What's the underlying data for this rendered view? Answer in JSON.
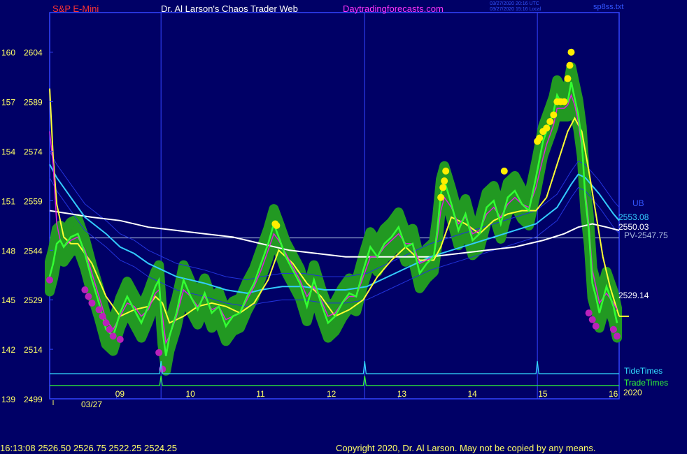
{
  "header": {
    "symbol": "S&P E-Mini",
    "site": "Dr. Al Larson's Chaos Trader Web",
    "url": "Daytradingforecasts.com",
    "time_utc": "03/27/2020 20:16 UTC",
    "time_local": "03/27/2020 15:16 Local",
    "file": "sp8ss.txt"
  },
  "footer": {
    "quote": "16:13:08  2526.50  2526.75  2522.25  2524.25",
    "copyright": "Copyright 2020, Dr. Al Larson. May not be copied by any means."
  },
  "colors": {
    "background": "#000066",
    "price": "#33ff33",
    "band": "#229922",
    "ema_fast": "#dd22dd",
    "ema_mid": "#ffff33",
    "ema_slow": "#33ccff",
    "ema_long": "#ffffff",
    "envelope": "#2233dd",
    "axis": "#3344ff",
    "tide": "#33ddff",
    "trade": "#33ff33"
  },
  "chart_data": {
    "type": "line",
    "x_tick_labels": [
      "09",
      "10",
      "11",
      "12",
      "13",
      "14",
      "15",
      "16"
    ],
    "x_ticks": [
      9,
      10,
      11,
      12,
      13,
      14,
      15,
      16
    ],
    "date_label": "03/27",
    "year_label": "2020",
    "xlim": [
      8.0,
      16.08
    ],
    "ylim": [
      2499,
      2616
    ],
    "y_ticks": [
      {
        "value": 2499,
        "left": "139",
        "right": "2499"
      },
      {
        "value": 2514,
        "left": "142",
        "right": "2514"
      },
      {
        "value": 2529,
        "left": "145",
        "right": "2529"
      },
      {
        "value": 2544,
        "left": "148",
        "right": "2544"
      },
      {
        "value": 2559,
        "left": "151",
        "right": "2559"
      },
      {
        "value": 2574,
        "left": "154",
        "right": "2574"
      },
      {
        "value": 2589,
        "left": "157",
        "right": "2589"
      },
      {
        "value": 2604,
        "left": "160",
        "right": "2604"
      }
    ],
    "vertical_markers": [
      9.58,
      12.47,
      14.92
    ],
    "pv_level": 2547.75,
    "labels": {
      "ub": "UB",
      "pv": "PV-2547.75",
      "tide": "TideTimes",
      "trade": "TradeTimes",
      "ema_slow_last": "2553.08",
      "ema_long_last": "2550.03",
      "ema_mid_last": "2529.14"
    },
    "tide_spikes": [
      9.58,
      12.47,
      14.92
    ],
    "trade_spikes": [
      9.58,
      12.47
    ],
    "price": {
      "x": [
        8.0,
        8.05,
        8.1,
        8.15,
        8.2,
        8.3,
        8.4,
        8.5,
        8.6,
        8.7,
        8.8,
        8.9,
        9.0,
        9.1,
        9.2,
        9.3,
        9.4,
        9.5,
        9.55,
        9.6,
        9.65,
        9.7,
        9.8,
        9.9,
        10.0,
        10.1,
        10.2,
        10.3,
        10.4,
        10.5,
        10.6,
        10.7,
        10.8,
        10.9,
        11.0,
        11.1,
        11.18,
        11.25,
        11.35,
        11.45,
        11.55,
        11.65,
        11.75,
        11.85,
        11.95,
        12.05,
        12.15,
        12.25,
        12.35,
        12.45,
        12.55,
        12.65,
        12.75,
        12.85,
        12.95,
        13.05,
        13.15,
        13.25,
        13.35,
        13.45,
        13.5,
        13.55,
        13.6,
        13.7,
        13.8,
        13.9,
        14.0,
        14.1,
        14.2,
        14.3,
        14.4,
        14.5,
        14.6,
        14.7,
        14.8,
        14.9,
        15.0,
        15.05,
        15.1,
        15.15,
        15.2,
        15.25,
        15.3,
        15.35,
        15.4,
        15.45,
        15.5,
        15.55,
        15.6,
        15.65,
        15.7,
        15.75,
        15.8,
        15.9,
        16.0,
        16.05
      ],
      "y": [
        2536,
        2540,
        2546,
        2547,
        2545,
        2548,
        2549,
        2543,
        2535,
        2528,
        2520,
        2518,
        2525,
        2530,
        2526,
        2522,
        2527,
        2533,
        2535,
        2520,
        2512,
        2518,
        2525,
        2535,
        2530,
        2526,
        2531,
        2525,
        2527,
        2521,
        2524,
        2525,
        2530,
        2534,
        2540,
        2546,
        2552,
        2548,
        2542,
        2538,
        2534,
        2527,
        2535,
        2528,
        2522,
        2524,
        2528,
        2531,
        2530,
        2538,
        2545,
        2542,
        2546,
        2548,
        2551,
        2545,
        2546,
        2537,
        2540,
        2542,
        2550,
        2561,
        2565,
        2558,
        2550,
        2555,
        2547,
        2549,
        2557,
        2559,
        2552,
        2560,
        2562,
        2558,
        2556,
        2566,
        2577,
        2580,
        2583,
        2586,
        2591,
        2589,
        2589,
        2589,
        2595,
        2590,
        2585,
        2577,
        2560,
        2550,
        2534,
        2530,
        2525,
        2533,
        2527,
        2522
      ]
    },
    "ema_fast": {
      "x": [
        8.0,
        8.05,
        8.1,
        8.15,
        8.2,
        8.3,
        8.4,
        8.5,
        8.6,
        8.7,
        8.8,
        8.9,
        9.0,
        9.1,
        9.2,
        9.3,
        9.4,
        9.5,
        9.55,
        9.6,
        9.65,
        9.7,
        9.8,
        9.9,
        10.0,
        10.1,
        10.2,
        10.3,
        10.4,
        10.5,
        10.6,
        10.7,
        10.8,
        10.9,
        11.0,
        11.1,
        11.18,
        11.25,
        11.35,
        11.45,
        11.55,
        11.65,
        11.75,
        11.85,
        11.95,
        12.05,
        12.15,
        12.25,
        12.35,
        12.45,
        12.55,
        12.65,
        12.75,
        12.85,
        12.95,
        13.05,
        13.15,
        13.25,
        13.35,
        13.45,
        13.5,
        13.55,
        13.6,
        13.7,
        13.8,
        13.9,
        14.0,
        14.1,
        14.2,
        14.3,
        14.4,
        14.5,
        14.6,
        14.7,
        14.8,
        14.9,
        15.0,
        15.05,
        15.1,
        15.15,
        15.2,
        15.25,
        15.3,
        15.35,
        15.4,
        15.45,
        15.5,
        15.55,
        15.6,
        15.65,
        15.7,
        15.75,
        15.8,
        15.9,
        16.0,
        16.05
      ],
      "y": [
        2580,
        2570,
        2552,
        2547,
        2545,
        2547,
        2548,
        2544,
        2537,
        2530,
        2523,
        2520,
        2524,
        2528,
        2527,
        2524,
        2526,
        2531,
        2532,
        2524,
        2516,
        2518,
        2524,
        2532,
        2530,
        2527,
        2530,
        2526,
        2527,
        2523,
        2524,
        2525,
        2529,
        2533,
        2538,
        2544,
        2549,
        2547,
        2543,
        2539,
        2535,
        2530,
        2533,
        2529,
        2524,
        2525,
        2528,
        2530,
        2530,
        2536,
        2542,
        2542,
        2545,
        2547,
        2549,
        2546,
        2546,
        2540,
        2541,
        2542,
        2548,
        2556,
        2560,
        2557,
        2552,
        2554,
        2549,
        2550,
        2555,
        2557,
        2554,
        2558,
        2560,
        2558,
        2557,
        2563,
        2572,
        2576,
        2579,
        2582,
        2587,
        2587,
        2587,
        2588,
        2591,
        2588,
        2583,
        2575,
        2562,
        2552,
        2538,
        2533,
        2528,
        2531,
        2528,
        2526
      ]
    },
    "ema_mid": {
      "x": [
        8.0,
        8.05,
        8.1,
        8.2,
        8.3,
        8.4,
        8.6,
        8.8,
        9.0,
        9.2,
        9.4,
        9.5,
        9.6,
        9.7,
        9.9,
        10.1,
        10.3,
        10.5,
        10.7,
        10.9,
        11.1,
        11.25,
        11.45,
        11.65,
        11.85,
        12.05,
        12.25,
        12.45,
        12.65,
        12.85,
        13.05,
        13.25,
        13.45,
        13.55,
        13.7,
        13.9,
        14.1,
        14.3,
        14.5,
        14.7,
        14.9,
        15.05,
        15.2,
        15.35,
        15.45,
        15.55,
        15.65,
        15.75,
        15.85,
        15.95,
        16.05,
        16.08
      ],
      "y": [
        2593,
        2572,
        2558,
        2548,
        2546,
        2546,
        2540,
        2530,
        2524,
        2526,
        2527,
        2530,
        2528,
        2522,
        2524,
        2527,
        2528,
        2527,
        2525,
        2528,
        2535,
        2544,
        2540,
        2534,
        2530,
        2524,
        2526,
        2529,
        2536,
        2541,
        2545,
        2541,
        2541,
        2545,
        2554,
        2552,
        2549,
        2553,
        2555,
        2556,
        2556,
        2560,
        2570,
        2580,
        2584,
        2580,
        2568,
        2555,
        2542,
        2533,
        2526,
        2524
      ]
    },
    "ema_slow": {
      "x": [
        8.0,
        8.1,
        8.3,
        8.5,
        8.8,
        9.0,
        9.2,
        9.4,
        9.6,
        9.8,
        10.0,
        10.2,
        10.5,
        10.8,
        11.0,
        11.3,
        11.6,
        11.9,
        12.2,
        12.5,
        12.8,
        13.1,
        13.4,
        13.7,
        14.0,
        14.3,
        14.6,
        14.9,
        15.2,
        15.4,
        15.5,
        15.6,
        15.8,
        16.0,
        16.08
      ],
      "y": [
        2570,
        2566,
        2560,
        2554,
        2549,
        2545,
        2543,
        2540,
        2538,
        2536,
        2535,
        2534,
        2532,
        2531,
        2532,
        2533,
        2533,
        2532,
        2532,
        2533,
        2536,
        2539,
        2542,
        2544,
        2546,
        2548,
        2550,
        2552,
        2557,
        2564,
        2567,
        2566,
        2561,
        2555,
        2553
      ]
    },
    "ema_long": {
      "x": [
        8.0,
        8.3,
        8.6,
        9.0,
        9.4,
        9.8,
        10.2,
        10.6,
        11.0,
        11.4,
        11.8,
        12.2,
        12.6,
        13.0,
        13.4,
        13.8,
        14.2,
        14.6,
        15.0,
        15.3,
        15.5,
        15.7,
        15.9,
        16.08
      ],
      "y": [
        2556,
        2555,
        2554,
        2553,
        2551,
        2550,
        2549,
        2548,
        2546,
        2544,
        2543,
        2542,
        2542,
        2542,
        2542,
        2543,
        2544,
        2545,
        2547,
        2549,
        2551,
        2552,
        2551,
        2550
      ]
    },
    "band_offsets": [
      -4.5,
      4.5
    ],
    "yellow_dots": [
      [
        11.2,
        2552
      ],
      [
        11.22,
        2551.5
      ],
      [
        13.55,
        2560
      ],
      [
        13.58,
        2563
      ],
      [
        13.6,
        2565
      ],
      [
        13.62,
        2568
      ],
      [
        14.45,
        2568
      ],
      [
        14.92,
        2577
      ],
      [
        14.95,
        2578
      ],
      [
        15.0,
        2580
      ],
      [
        15.05,
        2581
      ],
      [
        15.1,
        2583
      ],
      [
        15.15,
        2585
      ],
      [
        15.2,
        2589
      ],
      [
        15.25,
        2589
      ],
      [
        15.3,
        2589
      ],
      [
        15.35,
        2596
      ],
      [
        15.38,
        2600
      ],
      [
        15.4,
        2604
      ]
    ],
    "magenta_dots": [
      [
        8.0,
        2535
      ],
      [
        8.5,
        2532
      ],
      [
        8.55,
        2530
      ],
      [
        8.6,
        2528
      ],
      [
        8.7,
        2526
      ],
      [
        8.75,
        2524
      ],
      [
        8.8,
        2522
      ],
      [
        8.85,
        2520
      ],
      [
        8.9,
        2518
      ],
      [
        9.0,
        2517
      ],
      [
        9.55,
        2513
      ],
      [
        9.6,
        2508
      ],
      [
        15.65,
        2525
      ],
      [
        15.7,
        2523
      ],
      [
        15.75,
        2521
      ],
      [
        16.0,
        2520
      ],
      [
        16.05,
        2518
      ]
    ]
  }
}
